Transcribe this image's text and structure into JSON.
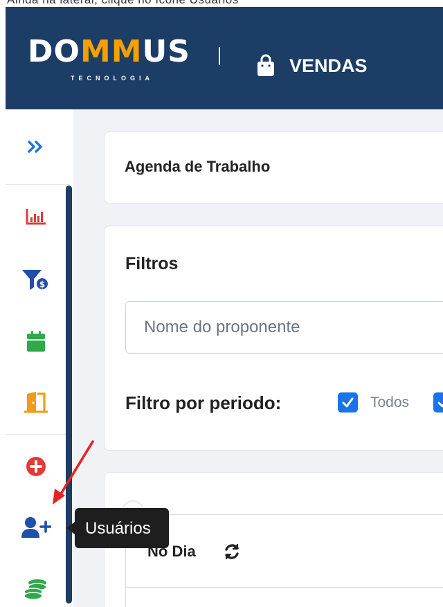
{
  "top_strip": {
    "text": "Ainda na lateral, clique no ícone Usuários"
  },
  "header": {
    "logo": {
      "text_left": "DO",
      "text_mm": "MM",
      "text_right": "US",
      "subtext": "TECNOLOGIA"
    },
    "separator": "|",
    "module_title": "VENDAS",
    "icon": "shopping-bag-icon"
  },
  "sidebar": {
    "expand_icon": "double-chevron-right-icon",
    "items": [
      {
        "name": "sidebar-item-reports",
        "icon": "bar-chart-icon",
        "color": "#e03a3a"
      },
      {
        "name": "sidebar-item-funnel",
        "icon": "funnel-dollar-icon",
        "color": "#1f4fa8"
      },
      {
        "name": "sidebar-item-calendar",
        "icon": "calendar-icon",
        "color": "#2eaa4a"
      },
      {
        "name": "sidebar-item-door",
        "icon": "door-open-icon",
        "color": "#f29a1a"
      },
      {
        "name": "sidebar-item-add",
        "icon": "plus-circle-icon",
        "color": "#e53935"
      },
      {
        "name": "sidebar-item-users",
        "icon": "user-plus-icon",
        "color": "#1f4fa8"
      },
      {
        "name": "sidebar-item-coins",
        "icon": "coins-icon",
        "color": "#2eaa4a"
      }
    ]
  },
  "agenda": {
    "title": "Agenda de Trabalho"
  },
  "filters": {
    "title": "Filtros",
    "name_input": {
      "placeholder": "Nome do proponente",
      "value": ""
    },
    "period_label": "Filtro por periodo:",
    "options": [
      {
        "label": "Todos",
        "checked": true
      }
    ]
  },
  "day_panel": {
    "title": "No Dia",
    "icon": "refresh-icon"
  },
  "tooltip": {
    "text": "Usuários"
  },
  "annotation": {
    "color": "#e8231e"
  },
  "colors": {
    "header_bg": "#1b3d66",
    "accent": "#1a73e8",
    "logo_accent": "#f5a000",
    "main_bg": "#f0f2f6"
  }
}
